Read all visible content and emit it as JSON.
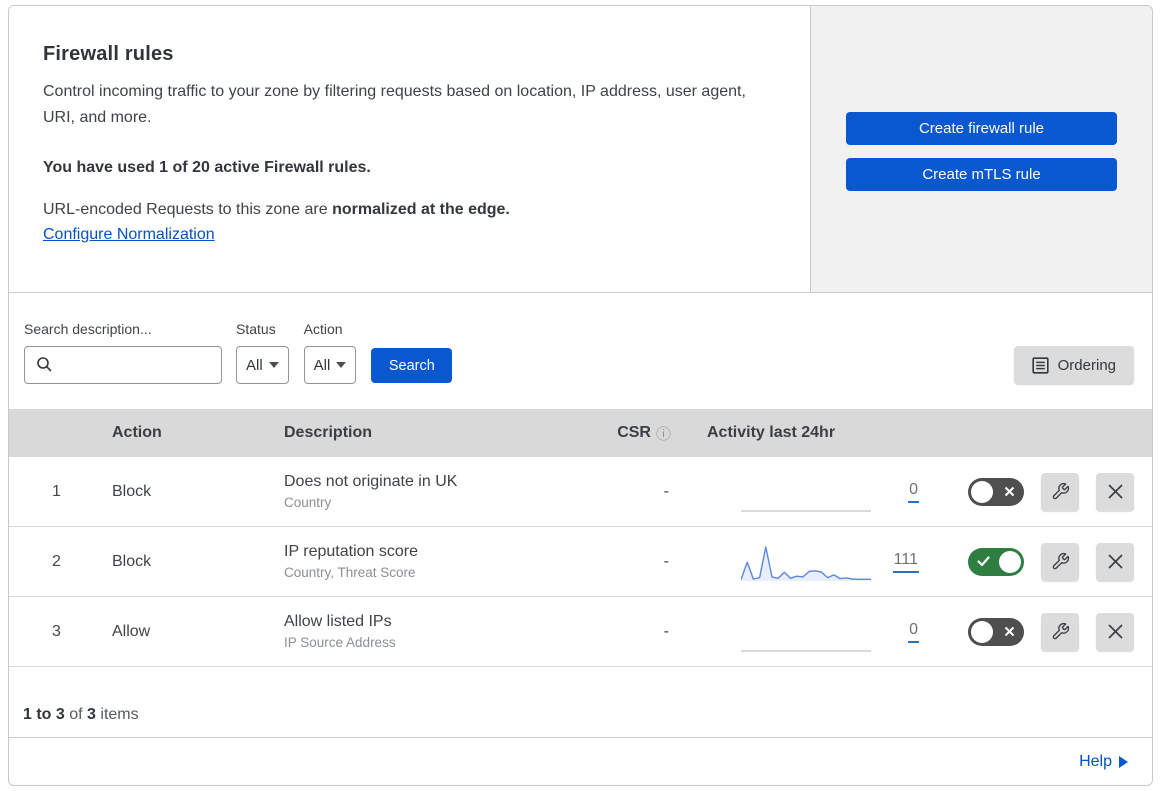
{
  "colors": {
    "accent_blue": "#0a58d0",
    "link_blue": "#0551c5",
    "toggle_on_green": "#2e7e41",
    "toggle_off_gray": "#4f4f4f",
    "panel_gray": "#f1f1f1",
    "table_header_gray": "#d9d9d9",
    "sparkline_blue": "#5b87dd"
  },
  "header": {
    "title": "Firewall rules",
    "description": "Control incoming traffic to your zone by filtering requests based on location, IP address, user agent, URI, and more.",
    "usage": "You have used 1 of 20 active Firewall rules.",
    "normalization_prefix": "URL-encoded Requests to this zone are ",
    "normalization_bold": "normalized at the edge.",
    "normalization_link": "Configure Normalization",
    "create_firewall_button": "Create firewall rule",
    "create_mtls_button": "Create mTLS rule"
  },
  "filters": {
    "search_label": "Search description...",
    "status_label": "Status",
    "status_value": "All",
    "action_label": "Action",
    "action_value": "All",
    "search_button": "Search",
    "ordering_button": "Ordering"
  },
  "table": {
    "columns": {
      "action": "Action",
      "description": "Description",
      "csr": "CSR",
      "csr_info_icon": "ⓘ",
      "activity": "Activity last 24hr"
    },
    "rows": [
      {
        "priority": "1",
        "action": "Block",
        "description": "Does not originate in UK",
        "fields": "Country",
        "csr": "-",
        "activity_count": "0",
        "enabled": false,
        "sparkline": null
      },
      {
        "priority": "2",
        "action": "Block",
        "description": "IP reputation score",
        "fields": "Country, Threat Score",
        "csr": "-",
        "activity_count": "111",
        "enabled": true,
        "sparkline": [
          4,
          55,
          6,
          10,
          100,
          12,
          8,
          26,
          8,
          14,
          12,
          28,
          30,
          26,
          10,
          18,
          7,
          9,
          6,
          5,
          5,
          5
        ]
      },
      {
        "priority": "3",
        "action": "Allow",
        "description": "Allow listed IPs",
        "fields": "IP Source Address",
        "csr": "-",
        "activity_count": "0",
        "enabled": false,
        "sparkline": null
      }
    ]
  },
  "footer": {
    "range": "1 to 3",
    "of": " of ",
    "total": "3",
    "items": " items",
    "help": "Help"
  },
  "chart_data": {
    "type": "line",
    "title": "Activity last 24hr — rule 2 (IP reputation score) sparkline",
    "x": [
      0,
      1,
      2,
      3,
      4,
      5,
      6,
      7,
      8,
      9,
      10,
      11,
      12,
      13,
      14,
      15,
      16,
      17,
      18,
      19,
      20,
      21
    ],
    "values": [
      4,
      55,
      6,
      10,
      100,
      12,
      8,
      26,
      8,
      14,
      12,
      28,
      30,
      26,
      10,
      18,
      7,
      9,
      6,
      5,
      5,
      5
    ],
    "total_events": 111,
    "ylim": [
      0,
      100
    ],
    "xlabel": "",
    "ylabel": "",
    "grid": false,
    "legend": "none"
  }
}
